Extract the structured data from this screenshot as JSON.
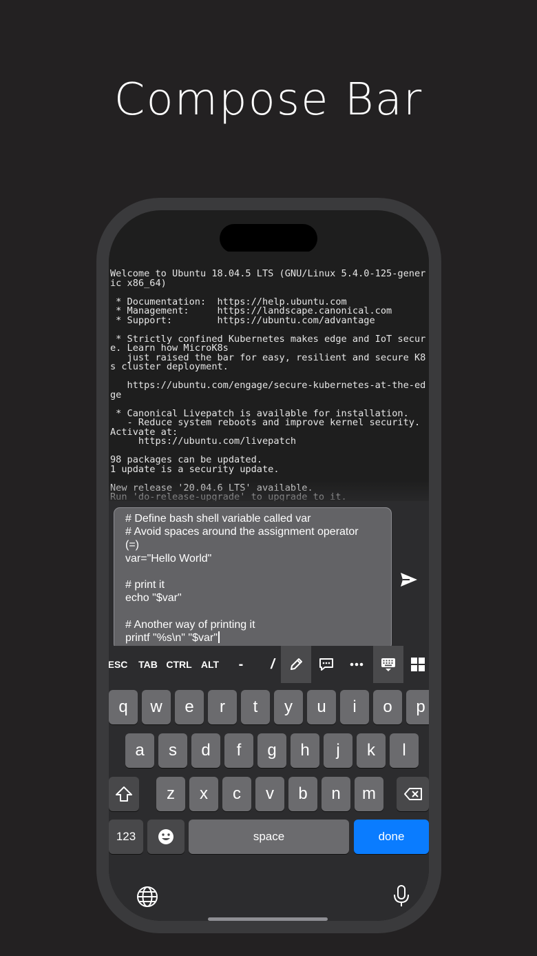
{
  "headline": "Compose Bar",
  "terminal": {
    "lines": [
      "Welcome to Ubuntu 18.04.5 LTS (GNU/Linux 5.4.0-125-gener",
      "ic x86_64)",
      "",
      " * Documentation:  https://help.ubuntu.com",
      " * Management:     https://landscape.canonical.com",
      " * Support:        https://ubuntu.com/advantage",
      "",
      " * Strictly confined Kubernetes makes edge and IoT secur",
      "e. Learn how MicroK8s",
      "   just raised the bar for easy, resilient and secure K8",
      "s cluster deployment.",
      "",
      "   https://ubuntu.com/engage/secure-kubernetes-at-the-ed",
      "ge",
      "",
      " * Canonical Livepatch is available for installation.",
      "   - Reduce system reboots and improve kernel security.",
      "Activate at:",
      "     https://ubuntu.com/livepatch",
      "",
      "98 packages can be updated.",
      "1 update is a security update.",
      "",
      "New release '20.04.6 LTS' available.",
      "Run 'do-release-upgrade' to upgrade to it."
    ]
  },
  "compose": {
    "lines": [
      "# Define bash shell variable called var",
      "# Avoid spaces around the assignment operator",
      "(=)",
      "var=\"Hello World\"",
      "",
      "# print it",
      "echo \"$var\"",
      "",
      "# Another way of printing it",
      "printf \"%s\\n\" \"$var\""
    ]
  },
  "keybar": {
    "esc": "ESC",
    "tab": "TAB",
    "ctrl": "CTRL",
    "alt": "ALT",
    "dash": "-",
    "slash": "/"
  },
  "keyboard": {
    "row1": [
      "q",
      "w",
      "e",
      "r",
      "t",
      "y",
      "u",
      "i",
      "o",
      "p"
    ],
    "row2": [
      "a",
      "s",
      "d",
      "f",
      "g",
      "h",
      "j",
      "k",
      "l"
    ],
    "row3": [
      "z",
      "x",
      "c",
      "v",
      "b",
      "n",
      "m"
    ],
    "num_label": "123",
    "space_label": "space",
    "done_label": "done"
  },
  "colors": {
    "accent": "#0a7cff",
    "background": "#232122",
    "terminal_bg": "#1e1e1e",
    "compose_bg": "#636366"
  }
}
